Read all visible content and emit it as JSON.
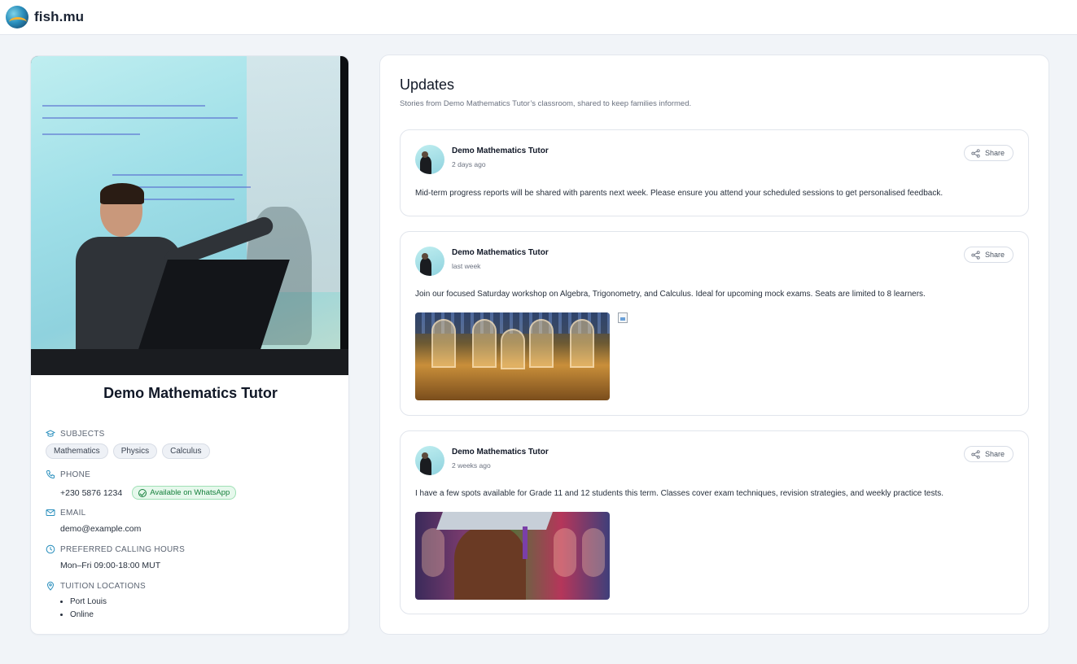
{
  "header": {
    "brand": "fish.mu",
    "logo_icon": "fish-mu-logo-icon"
  },
  "profile": {
    "name": "Demo Mathematics Tutor",
    "subjects_label": "SUBJECTS",
    "subjects": [
      "Mathematics",
      "Physics",
      "Calculus"
    ],
    "phone_label": "PHONE",
    "phone": "+230 5876 1234",
    "whatsapp_badge": "Available on WhatsApp",
    "email_label": "EMAIL",
    "email": "demo@example.com",
    "hours_label": "PREFERRED CALLING HOURS",
    "hours": "Mon–Fri 09:00-18:00 MUT",
    "locations_label": "TUITION LOCATIONS",
    "locations": [
      "Port Louis",
      "Online"
    ]
  },
  "updates": {
    "title": "Updates",
    "subtitle": "Stories from Demo Mathematics Tutor’s classroom, shared to keep families informed.",
    "share_label": "Share",
    "posts": [
      {
        "author": "Demo Mathematics Tutor",
        "when": "2 days ago",
        "text": "Mid-term progress reports will be shared with parents next week. Please ensure you attend your scheduled sessions to get personalised feedback."
      },
      {
        "author": "Demo Mathematics Tutor",
        "when": "last week",
        "text": "Join our focused Saturday workshop on Algebra, Trigonometry, and Calculus. Ideal for upcoming mock exams. Seats are limited to 8 learners."
      },
      {
        "author": "Demo Mathematics Tutor",
        "when": "2 weeks ago",
        "text": "I have a few spots available for Grade 11 and 12 students this term. Classes cover exam techniques, revision strategies, and weekly practice tests."
      }
    ]
  },
  "colors": {
    "accent": "#2a8fbd",
    "background": "#f1f4f8",
    "whatsapp_green": "#16803c"
  }
}
